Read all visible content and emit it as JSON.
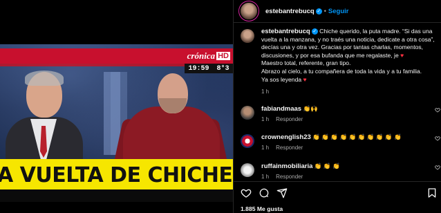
{
  "broadcast": {
    "channel": "crónica",
    "channel_hd": "HD",
    "time": "19:59",
    "temperature": "8°3",
    "headline": "A VUELTA DE CHICHE"
  },
  "post": {
    "author": "estebantrebucq",
    "follow_label": "Seguir",
    "caption": "Chiche querido, la puta madre. “Si das una vuelta a la manzana, y no traés una noticia, dedicate a otra cosa”, decías una y otra vez. Gracias por tantas charlas, momentos, discusiones, y por esa bufanda que me regalaste, je ",
    "caption_heart": "♥",
    "caption_2": "Maestro total, referente, gran tipo.\nAbrazo al cielo, a tu compañera de toda la vida y a tu familia.\nYa sos leyenda ",
    "caption_heart_2": "♥",
    "time_ago": "1 h"
  },
  "comments": [
    {
      "user": "fabiandmaas",
      "text": "👏🙌",
      "time": "1 h",
      "reply": "Responder"
    },
    {
      "user": "crownenglish23",
      "text": "👏 👏 👏 👏 👏 👏 👏 👏 👏 👏",
      "time": "1 h",
      "reply": "Responder"
    },
    {
      "user": "ruffainmobiliaria",
      "text": "👏 👏 👏",
      "time": "1 h",
      "reply": "Responder"
    }
  ],
  "likes": "1.885 Me gusta",
  "colors": {
    "accent": "#0095f6",
    "heart": "#ff3040",
    "headline_bg": "#f6e600",
    "channel_red": "#c8102e"
  },
  "icons": [
    "heart-icon",
    "comment-icon",
    "share-icon",
    "bookmark-icon"
  ]
}
